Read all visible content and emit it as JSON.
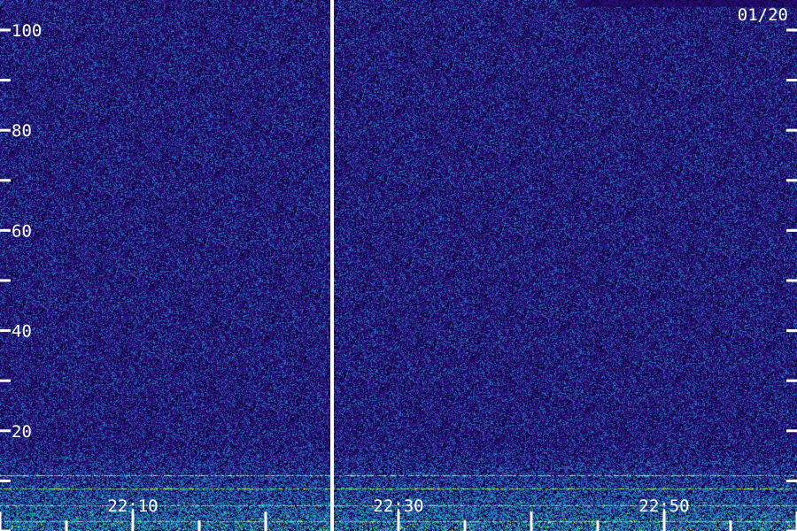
{
  "chart_data": {
    "type": "heatmap",
    "title": "",
    "xlabel": "",
    "ylabel": "",
    "date_label": "01/20",
    "y_ticks": [
      {
        "value": 100,
        "label": "100"
      },
      {
        "value": 80,
        "label": "80"
      },
      {
        "value": 60,
        "label": "60"
      },
      {
        "value": 40,
        "label": "40"
      },
      {
        "value": 20,
        "label": "20"
      }
    ],
    "y_minor_ticks": [
      0,
      10,
      30,
      50,
      70,
      90,
      100
    ],
    "ylim": [
      0,
      106
    ],
    "x_ticks": [
      {
        "value": "22:10",
        "label": "22:10"
      },
      {
        "value": "22:30",
        "label": "22:30"
      },
      {
        "value": "22:50",
        "label": "22:50"
      }
    ],
    "xlim": [
      "22:00",
      "23:00"
    ],
    "gap_marker_time": "22:25",
    "grid": false,
    "colors": {
      "background": "#1a0f52",
      "low": "#2a1a8a",
      "mid": "#2f5fd0",
      "high": "#1fd0a0",
      "peak": "#e8ff30",
      "axis": "#ffffff"
    }
  }
}
